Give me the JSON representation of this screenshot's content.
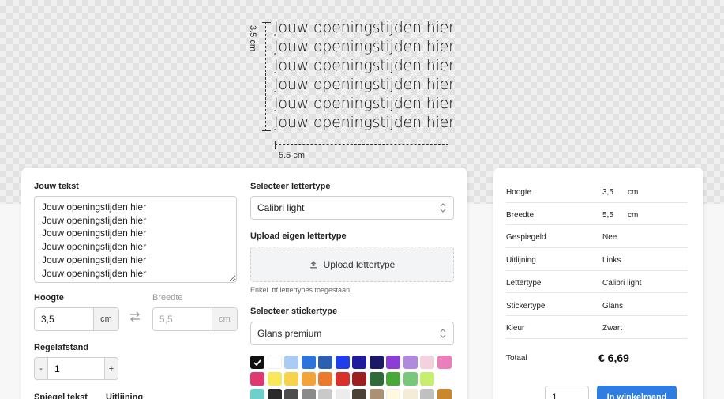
{
  "preview": {
    "lines": [
      "Jouw openingstijden hier",
      "Jouw openingstijden hier",
      "Jouw openingstijden hier",
      "Jouw openingstijden hier",
      "Jouw openingstijden hier",
      "Jouw openingstijden hier"
    ],
    "height_label": "3.5 cm",
    "width_label": "5.5 cm"
  },
  "editor": {
    "text_label": "Jouw tekst",
    "text_value": "Jouw openingstijden hier\nJouw openingstijden hier\nJouw openingstijden hier\nJouw openingstijden hier\nJouw openingstijden hier\nJouw openingstijden hier",
    "height_label": "Hoogte",
    "height_value": "3,5",
    "height_unit": "cm",
    "width_label": "Breedte",
    "width_value": "5,5",
    "width_unit": "cm",
    "spacing_label": "Regelafstand",
    "spacing_value": "1",
    "minus": "-",
    "plus": "+",
    "mirror_label": "Spiegel tekst",
    "align_label": "Uitlijning",
    "font_label": "Selecteer lettertype",
    "font_value": "Calibri light",
    "upload_label": "Upload eigen lettertype",
    "upload_button": "Upload lettertype",
    "upload_note": "Enkel .ttf lettertypes toegestaan.",
    "sticker_label": "Selecteer stickertype",
    "sticker_value": "Glans premium"
  },
  "colors": {
    "selected_index": 0,
    "swatches": [
      "#111111",
      "#ffffff",
      "#a9cbf4",
      "#2c74da",
      "#2b5fb0",
      "#1f3de8",
      "#1f1b9a",
      "#1b1866",
      "#8a3ed6",
      "#b18ae0",
      "#f3d2de",
      "#e97fbb",
      "#e0396f",
      "#f9e85a",
      "#f7d24b",
      "#f2a43a",
      "#ec7a2c",
      "#d9302a",
      "#9e1f1f",
      "#2e6b38",
      "#49a83a",
      "#79c77a",
      "#c8ee6f",
      "",
      "#6fcfcb",
      "#2a2a2a",
      "#4d4d4d",
      "#8a8a8a",
      "#c9c9c9",
      "#ececec",
      "#4d4237",
      "#a89273",
      "#fffadf",
      "#f4ecd6",
      "#c0c0c0",
      "#c9872e"
    ]
  },
  "summary": {
    "rows": [
      {
        "k": "Hoogte",
        "v": "3,5",
        "u": "cm"
      },
      {
        "k": "Breedte",
        "v": "5,5",
        "u": "cm"
      },
      {
        "k": "Gespiegeld",
        "v": "Nee",
        "u": ""
      },
      {
        "k": "Uitlijning",
        "v": "Links",
        "u": ""
      },
      {
        "k": "Lettertype",
        "v": "Calibri light",
        "u": ""
      },
      {
        "k": "Stickertype",
        "v": "Glans",
        "u": ""
      },
      {
        "k": "Kleur",
        "v": "Zwart",
        "u": ""
      }
    ],
    "total_label": "Totaal",
    "total_value": "€ 6,69",
    "qty_value": "1",
    "cart_label": "In winkelmand"
  }
}
